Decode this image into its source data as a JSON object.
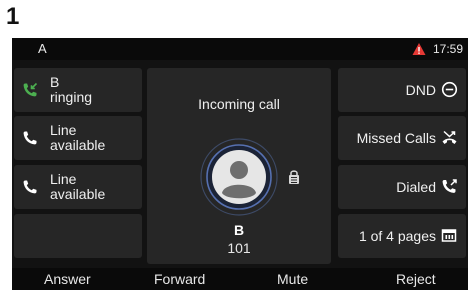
{
  "figure_label": "1",
  "status_bar": {
    "account": "A",
    "time": "17:59",
    "warning_icon": "warning-triangle-icon",
    "warning_color": "#e53935"
  },
  "lines": [
    {
      "label_line1": "B",
      "label_line2": "ringing",
      "icon": "incoming-call-icon",
      "icon_color": "#4caf50"
    },
    {
      "label_line1": "Line",
      "label_line2": "available",
      "icon": "phone-icon",
      "icon_color": "#ffffff"
    },
    {
      "label_line1": "Line",
      "label_line2": "available",
      "icon": "phone-icon",
      "icon_color": "#ffffff"
    }
  ],
  "call": {
    "status": "Incoming call",
    "caller_name": "B",
    "caller_number": "101"
  },
  "right_keys": [
    {
      "label": "DND",
      "icon": "dnd-icon"
    },
    {
      "label": "Missed Calls",
      "icon": "missed-call-icon"
    },
    {
      "label": "Dialed",
      "icon": "outgoing-call-icon"
    },
    {
      "label": "1 of 4 pages",
      "icon": "pages-icon"
    }
  ],
  "softkeys": [
    "Answer",
    "Forward",
    "Mute",
    "Reject"
  ]
}
